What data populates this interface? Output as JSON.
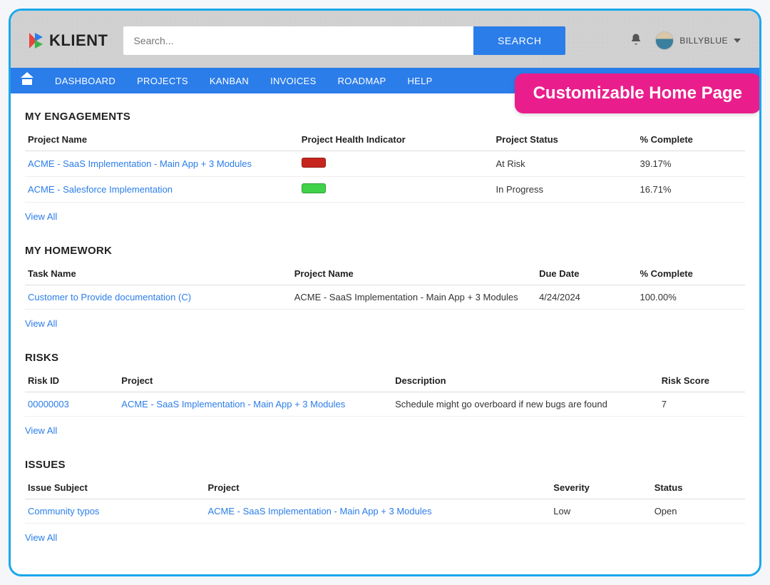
{
  "brand": {
    "name": "KLIENT"
  },
  "search": {
    "placeholder": "Search...",
    "button": "SEARCH"
  },
  "user": {
    "name": "BILLYBLUE"
  },
  "nav": {
    "items": [
      "DASHBOARD",
      "PROJECTS",
      "KANBAN",
      "INVOICES",
      "ROADMAP",
      "HELP"
    ]
  },
  "callout": "Customizable Home Page",
  "engagements": {
    "title": "MY ENGAGEMENTS",
    "headers": [
      "Project Name",
      "Project Health Indicator",
      "Project Status",
      "% Complete"
    ],
    "rows": [
      {
        "name": "ACME - SaaS Implementation - Main App + 3 Modules",
        "health": "red",
        "status": "At Risk",
        "pct": "39.17%"
      },
      {
        "name": "ACME - Salesforce Implementation",
        "health": "green",
        "status": "In Progress",
        "pct": "16.71%"
      }
    ],
    "viewall": "View All"
  },
  "homework": {
    "title": "MY HOMEWORK",
    "headers": [
      "Task Name",
      "Project Name",
      "Due Date",
      "% Complete"
    ],
    "rows": [
      {
        "task": "Customer to Provide documentation (C)",
        "project": "ACME - SaaS Implementation - Main App + 3 Modules",
        "due": "4/24/2024",
        "pct": "100.00%"
      }
    ],
    "viewall": "View All"
  },
  "risks": {
    "title": "RISKS",
    "headers": [
      "Risk ID",
      "Project",
      "Description",
      "Risk Score"
    ],
    "rows": [
      {
        "id": "00000003",
        "project": "ACME - SaaS Implementation - Main App + 3 Modules",
        "desc": "Schedule might go overboard if new bugs are found",
        "score": "7"
      }
    ],
    "viewall": "View All"
  },
  "issues": {
    "title": "ISSUES",
    "headers": [
      "Issue Subject",
      "Project",
      "Severity",
      "Status"
    ],
    "rows": [
      {
        "subject": "Community typos",
        "project": "ACME - SaaS Implementation - Main App + 3 Modules",
        "severity": "Low",
        "status": "Open"
      }
    ],
    "viewall": "View All"
  }
}
